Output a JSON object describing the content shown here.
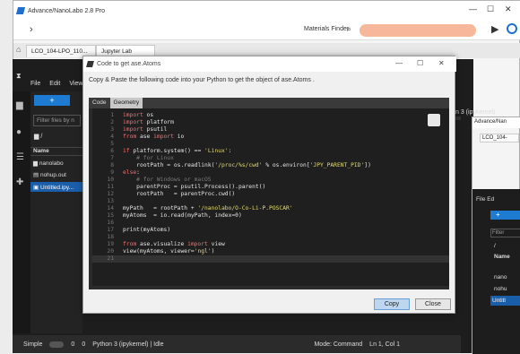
{
  "app": {
    "title": "Advance/NanoLabo 2.8 Pro",
    "finder_label": "Materials Finder",
    "finder_value": ""
  },
  "tabs": [
    {
      "label": "LCO_104-LPO_110..."
    },
    {
      "label": "Jupyter Lab"
    }
  ],
  "jupyter": {
    "menu": [
      "File",
      "Edit",
      "View"
    ],
    "new_label": "+",
    "filter_placeholder": "Filter files by n",
    "path": "/",
    "header_name": "Name",
    "files": [
      "nanolabo",
      "nohup.out",
      "Untitled.ipy..."
    ],
    "kernel_badge": "n 3 (ipykernel)",
    "status": {
      "mode": "Simple",
      "n0": "0",
      "n1": "0",
      "kernel": "Python 3 (ipykernel) | Idle",
      "modecmd": "Mode: Command",
      "pos": "Ln 1, Col 1"
    }
  },
  "win2": {
    "title": "Advance/Nan",
    "tab": "LCO_104-",
    "menu": [
      "File",
      "Ed"
    ],
    "filter_placeholder": "Filter",
    "path": "/",
    "header_name": "Name",
    "files": [
      "nano",
      "nohu",
      "Untitl"
    ]
  },
  "dialog": {
    "title": "Code to get ase.Atoms",
    "instruction": "Copy & Paste the following code into your Python to get the object of ase.Atoms .",
    "tabs": [
      "Code",
      "Geometry"
    ],
    "copy_label": "Copy",
    "close_label": "Close",
    "line_numbers": [
      "1",
      "2",
      "3",
      "4",
      "5",
      "6",
      "7",
      "8",
      "9",
      "10",
      "11",
      "12",
      "13",
      "14",
      "15",
      "16",
      "17",
      "18",
      "19",
      "20",
      "21"
    ],
    "code_lines": [
      "import os",
      "import platform",
      "import psutil",
      "from ase import io",
      "",
      "if platform.system() == 'Linux':",
      "    # for Linux",
      "    rootPath = os.readlink('/proc/%s/cwd' % os.environ['JPY_PARENT_PID'])",
      "else:",
      "    # for Windows or macOS",
      "    parentProc = psutil.Process().parent()",
      "    rootPath   = parentProc.cwd()",
      "",
      "myPath   = rootPath + '/nanolabo/O-Co-Li-P.POSCAR'",
      "myAtoms  = io.read(myPath, index=0)",
      "",
      "print(myAtoms)",
      "",
      "from ase.visualize import view",
      "view(myAtoms, viewer='ngl')",
      ""
    ]
  }
}
